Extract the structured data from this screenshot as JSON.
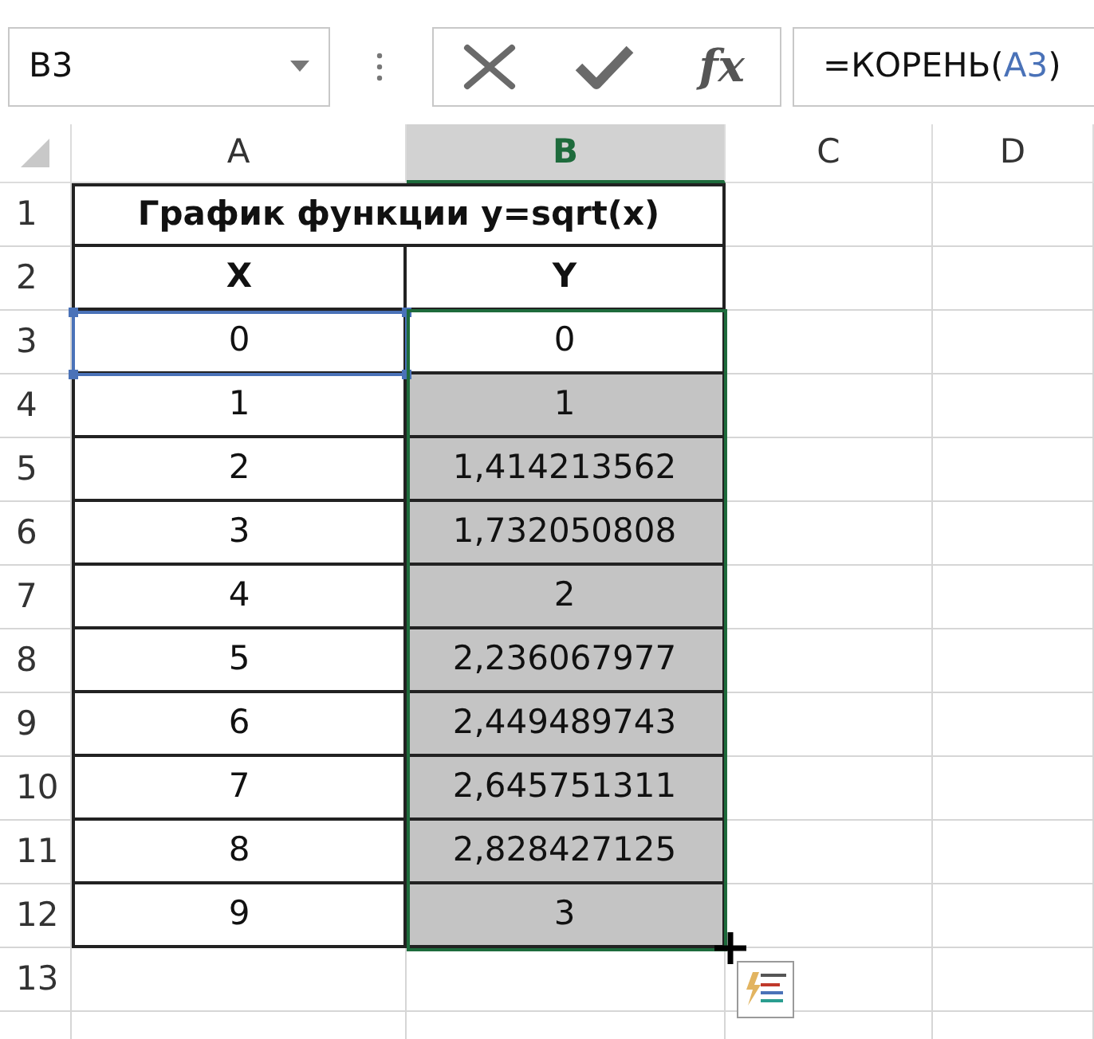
{
  "formula_bar": {
    "name_box": "B3",
    "function_button": "fx",
    "formula": [
      {
        "text": "=КОРЕНЬ(",
        "kind": "plain"
      },
      {
        "text": "A3",
        "kind": "reference"
      },
      {
        "text": ")",
        "kind": "plain"
      }
    ]
  },
  "columns": [
    {
      "label": "A",
      "selected": false
    },
    {
      "label": "B",
      "selected": true
    },
    {
      "label": "C",
      "selected": false
    },
    {
      "label": "D",
      "selected": false
    }
  ],
  "rows": [
    {
      "number": "1",
      "kind": "title",
      "cells": [
        {
          "text": "График функции y=sqrt(x)"
        }
      ]
    },
    {
      "number": "2",
      "kind": "header",
      "cells": [
        {
          "text": "X"
        },
        {
          "text": "Y"
        }
      ]
    },
    {
      "number": "3",
      "kind": "data",
      "cells": [
        {
          "text": "0",
          "highlighted": false
        },
        {
          "text": "0",
          "highlighted": false
        }
      ]
    },
    {
      "number": "4",
      "kind": "data",
      "cells": [
        {
          "text": "1",
          "highlighted": false
        },
        {
          "text": "1",
          "highlighted": true
        }
      ]
    },
    {
      "number": "5",
      "kind": "data",
      "cells": [
        {
          "text": "2",
          "highlighted": false
        },
        {
          "text": "1,414213562",
          "highlighted": true
        }
      ]
    },
    {
      "number": "6",
      "kind": "data",
      "cells": [
        {
          "text": "3",
          "highlighted": false
        },
        {
          "text": "1,732050808",
          "highlighted": true
        }
      ]
    },
    {
      "number": "7",
      "kind": "data",
      "cells": [
        {
          "text": "4",
          "highlighted": false
        },
        {
          "text": "2",
          "highlighted": true
        }
      ]
    },
    {
      "number": "8",
      "kind": "data",
      "cells": [
        {
          "text": "5",
          "highlighted": false
        },
        {
          "text": "2,236067977",
          "highlighted": true
        }
      ]
    },
    {
      "number": "9",
      "kind": "data",
      "cells": [
        {
          "text": "6",
          "highlighted": false
        },
        {
          "text": "2,449489743",
          "highlighted": true
        }
      ]
    },
    {
      "number": "10",
      "kind": "data",
      "cells": [
        {
          "text": "7",
          "highlighted": false
        },
        {
          "text": "2,645751311",
          "highlighted": true
        }
      ]
    },
    {
      "number": "11",
      "kind": "data",
      "cells": [
        {
          "text": "8",
          "highlighted": false
        },
        {
          "text": "2,828427125",
          "highlighted": true
        }
      ]
    },
    {
      "number": "12",
      "kind": "data",
      "cells": [
        {
          "text": "9",
          "highlighted": false
        },
        {
          "text": "3",
          "highlighted": true
        }
      ]
    },
    {
      "number": "13",
      "kind": "empty",
      "cells": []
    }
  ]
}
